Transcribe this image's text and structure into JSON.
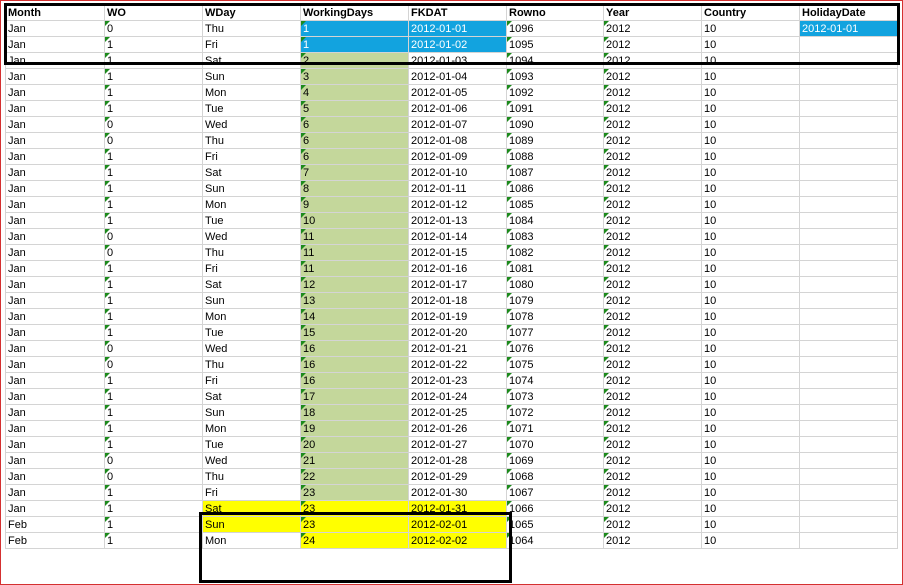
{
  "colors": {
    "blue_highlight": "#12a3df",
    "green_fill": "#c4d79b",
    "yellow_fill": "#ffff00"
  },
  "headers": [
    "Month",
    "WO",
    "WDay",
    "WorkingDays",
    "FKDAT",
    "Rowno",
    "Year",
    "Country",
    "HolidayDate"
  ],
  "rows": [
    [
      "Jan",
      "0",
      "Thu",
      "1",
      "2012-01-01",
      "1096",
      "2012",
      "10",
      "2012-01-01"
    ],
    [
      "Jan",
      "1",
      "Fri",
      "1",
      "2012-01-02",
      "1095",
      "2012",
      "10",
      ""
    ],
    [
      "Jan",
      "1",
      "Sat",
      "2",
      "2012-01-03",
      "1094",
      "2012",
      "10",
      ""
    ],
    [
      "Jan",
      "1",
      "Sun",
      "3",
      "2012-01-04",
      "1093",
      "2012",
      "10",
      ""
    ],
    [
      "Jan",
      "1",
      "Mon",
      "4",
      "2012-01-05",
      "1092",
      "2012",
      "10",
      ""
    ],
    [
      "Jan",
      "1",
      "Tue",
      "5",
      "2012-01-06",
      "1091",
      "2012",
      "10",
      ""
    ],
    [
      "Jan",
      "0",
      "Wed",
      "6",
      "2012-01-07",
      "1090",
      "2012",
      "10",
      ""
    ],
    [
      "Jan",
      "0",
      "Thu",
      "6",
      "2012-01-08",
      "1089",
      "2012",
      "10",
      ""
    ],
    [
      "Jan",
      "1",
      "Fri",
      "6",
      "2012-01-09",
      "1088",
      "2012",
      "10",
      ""
    ],
    [
      "Jan",
      "1",
      "Sat",
      "7",
      "2012-01-10",
      "1087",
      "2012",
      "10",
      ""
    ],
    [
      "Jan",
      "1",
      "Sun",
      "8",
      "2012-01-11",
      "1086",
      "2012",
      "10",
      ""
    ],
    [
      "Jan",
      "1",
      "Mon",
      "9",
      "2012-01-12",
      "1085",
      "2012",
      "10",
      ""
    ],
    [
      "Jan",
      "1",
      "Tue",
      "10",
      "2012-01-13",
      "1084",
      "2012",
      "10",
      ""
    ],
    [
      "Jan",
      "0",
      "Wed",
      "11",
      "2012-01-14",
      "1083",
      "2012",
      "10",
      ""
    ],
    [
      "Jan",
      "0",
      "Thu",
      "11",
      "2012-01-15",
      "1082",
      "2012",
      "10",
      ""
    ],
    [
      "Jan",
      "1",
      "Fri",
      "11",
      "2012-01-16",
      "1081",
      "2012",
      "10",
      ""
    ],
    [
      "Jan",
      "1",
      "Sat",
      "12",
      "2012-01-17",
      "1080",
      "2012",
      "10",
      ""
    ],
    [
      "Jan",
      "1",
      "Sun",
      "13",
      "2012-01-18",
      "1079",
      "2012",
      "10",
      ""
    ],
    [
      "Jan",
      "1",
      "Mon",
      "14",
      "2012-01-19",
      "1078",
      "2012",
      "10",
      ""
    ],
    [
      "Jan",
      "1",
      "Tue",
      "15",
      "2012-01-20",
      "1077",
      "2012",
      "10",
      ""
    ],
    [
      "Jan",
      "0",
      "Wed",
      "16",
      "2012-01-21",
      "1076",
      "2012",
      "10",
      ""
    ],
    [
      "Jan",
      "0",
      "Thu",
      "16",
      "2012-01-22",
      "1075",
      "2012",
      "10",
      ""
    ],
    [
      "Jan",
      "1",
      "Fri",
      "16",
      "2012-01-23",
      "1074",
      "2012",
      "10",
      ""
    ],
    [
      "Jan",
      "1",
      "Sat",
      "17",
      "2012-01-24",
      "1073",
      "2012",
      "10",
      ""
    ],
    [
      "Jan",
      "1",
      "Sun",
      "18",
      "2012-01-25",
      "1072",
      "2012",
      "10",
      ""
    ],
    [
      "Jan",
      "1",
      "Mon",
      "19",
      "2012-01-26",
      "1071",
      "2012",
      "10",
      ""
    ],
    [
      "Jan",
      "1",
      "Tue",
      "20",
      "2012-01-27",
      "1070",
      "2012",
      "10",
      ""
    ],
    [
      "Jan",
      "0",
      "Wed",
      "21",
      "2012-01-28",
      "1069",
      "2012",
      "10",
      ""
    ],
    [
      "Jan",
      "0",
      "Thu",
      "22",
      "2012-01-29",
      "1068",
      "2012",
      "10",
      ""
    ],
    [
      "Jan",
      "1",
      "Fri",
      "23",
      "2012-01-30",
      "1067",
      "2012",
      "10",
      ""
    ],
    [
      "Jan",
      "1",
      "Sat",
      "23",
      "2012-01-31",
      "1066",
      "2012",
      "10",
      ""
    ],
    [
      "Feb",
      "1",
      "Sun",
      "23",
      "2012-02-01",
      "1065",
      "2012",
      "10",
      ""
    ],
    [
      "Feb",
      "1",
      "Mon",
      "24",
      "2012-02-02",
      "1064",
      "2012",
      "10",
      ""
    ]
  ]
}
